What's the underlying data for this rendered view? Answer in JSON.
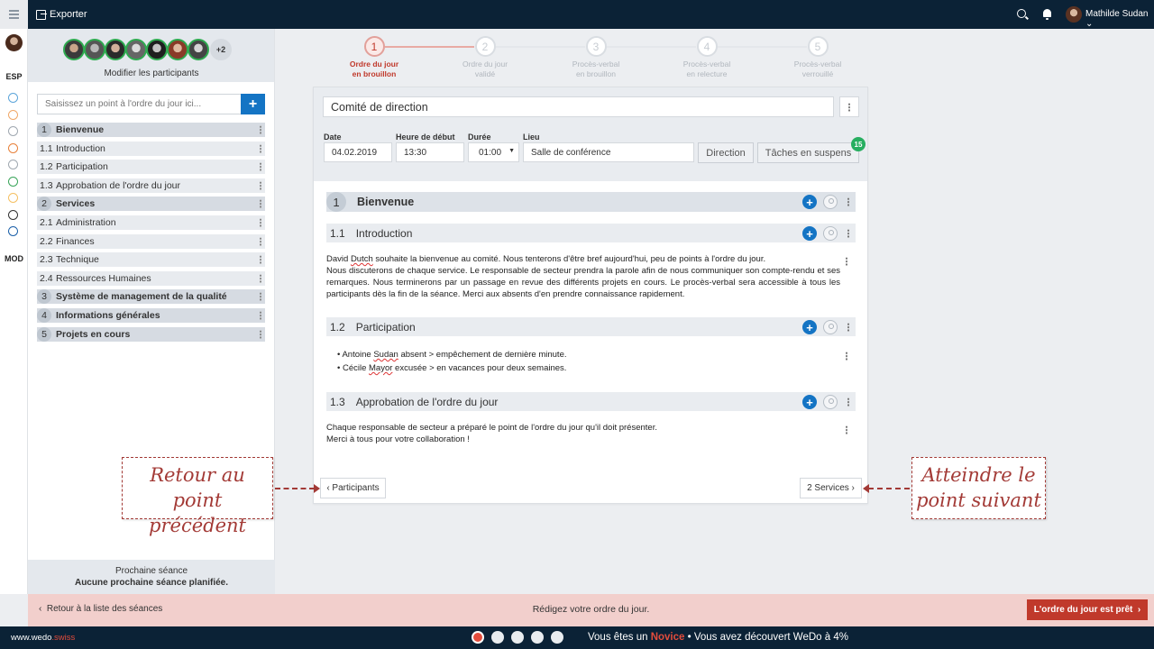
{
  "topbar": {
    "export_label": "Exporter",
    "user_name": "Mathilde Sudan"
  },
  "rail": {
    "esp_label": "ESP",
    "mod_label": "MOD",
    "dot_colors": [
      "#5da5da",
      "#f0a868",
      "#a0a8b0",
      "#e8813a",
      "#a0a8b0",
      "#3aa55a",
      "#f5c063",
      "#333333",
      "#1a5fa8"
    ]
  },
  "side": {
    "more_count": "+2",
    "modify_label": "Modifier les participants",
    "add_placeholder": "Saisissez un point à l'ordre du jour ici...",
    "add_button": "+",
    "agenda": [
      {
        "num": "1",
        "label": "Bienvenue",
        "top": true
      },
      {
        "num": "1.1",
        "label": "Introduction",
        "top": false
      },
      {
        "num": "1.2",
        "label": "Participation",
        "top": false
      },
      {
        "num": "1.3",
        "label": "Approbation de l'ordre du jour",
        "top": false
      },
      {
        "num": "2",
        "label": "Services",
        "top": true
      },
      {
        "num": "2.1",
        "label": "Administration",
        "top": false
      },
      {
        "num": "2.2",
        "label": "Finances",
        "top": false
      },
      {
        "num": "2.3",
        "label": "Technique",
        "top": false
      },
      {
        "num": "2.4",
        "label": "Ressources Humaines",
        "top": false
      },
      {
        "num": "3",
        "label": "Système de management de la qualité",
        "top": true
      },
      {
        "num": "4",
        "label": "Informations générales",
        "top": true
      },
      {
        "num": "5",
        "label": "Projets en cours",
        "top": true
      }
    ],
    "next_meeting_label": "Prochaine séance",
    "next_meeting_value": "Aucune prochaine séance planifiée."
  },
  "stepper": [
    {
      "n": "1",
      "line1": "Ordre du jour",
      "line2": "en brouillon",
      "active": true
    },
    {
      "n": "2",
      "line1": "Ordre du jour",
      "line2": "validé",
      "active": false
    },
    {
      "n": "3",
      "line1": "Procès-verbal",
      "line2": "en brouillon",
      "active": false
    },
    {
      "n": "4",
      "line1": "Procès-verbal",
      "line2": "en relecture",
      "active": false
    },
    {
      "n": "5",
      "line1": "Procès-verbal",
      "line2": "verrouillé",
      "active": false
    }
  ],
  "meeting": {
    "title": "Comité de direction",
    "date_label": "Date",
    "date_value": "04.02.2019",
    "start_label": "Heure de début",
    "start_value": "13:30",
    "duration_label": "Durée",
    "duration_value": "01:00",
    "place_label": "Lieu",
    "place_value": "Salle de conférence",
    "direction_button": "Direction",
    "pending_button": "Tâches en suspens",
    "pending_count": "15"
  },
  "sections": {
    "s1": {
      "num": "1",
      "label": "Bienvenue"
    },
    "s11": {
      "num": "1.1",
      "label": "Introduction"
    },
    "s12": {
      "num": "1.2",
      "label": "Participation"
    },
    "s13": {
      "num": "1.3",
      "label": "Approbation de l'ordre du jour"
    }
  },
  "content": {
    "intro_p1_a": "David ",
    "intro_p1_u": "Dutch",
    "intro_p1_b": " souhaite la bienvenue au comité. Nous tenterons d'être bref aujourd'hui, peu de points à l'ordre du jour.",
    "intro_p2": "Nous discuterons de chaque service. Le responsable de secteur prendra la parole afin de nous communiquer son compte-rendu et ses remarques. Nous terminerons par un passage en revue des différents projets en cours. Le procès-verbal sera accessible à tous les participants dès la fin de la séance. Merci aux absents d'en prendre connaissance rapidement.",
    "part_li1_a": "Antoine ",
    "part_li1_u": "Sudan",
    "part_li1_b": " absent > empêchement de dernière minute.",
    "part_li2_a": "Cécile ",
    "part_li2_u": "Mayor",
    "part_li2_b": " excusée > en vacances pour deux semaines.",
    "appr_l1": "Chaque responsable de secteur a préparé le point de l'ordre du jour qu'il doit présenter.",
    "appr_l2": "Merci à tous pour votre collaboration !"
  },
  "nav": {
    "prev_label": "Participants",
    "next_label": "2 Services"
  },
  "callouts": {
    "left_l1": "Retour au point",
    "left_l2": "précédent",
    "right_l1": "Atteindre le",
    "right_l2": "point suivant"
  },
  "actionbar": {
    "back_label": "Retour à la liste des séances",
    "message": "Rédigez votre ordre du jour.",
    "ready_button": "L'ordre du jour est prêt"
  },
  "footer": {
    "brand_main": "www.wedo",
    "brand_suffix": ".swiss",
    "level_prefix": "Vous êtes un ",
    "level_name": "Novice",
    "level_suffix": " • Vous avez découvert WeDo à 4%",
    "progress_current_step": 1,
    "progress_total_steps": 5
  },
  "colors": {
    "brand_dark": "#0b2236",
    "accent_blue": "#1474c4",
    "accent_red": "#c0392b",
    "badge_green": "#27ae60"
  }
}
